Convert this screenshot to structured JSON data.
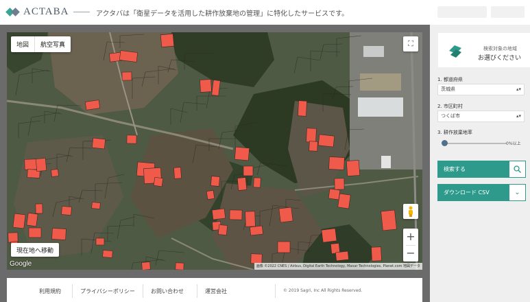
{
  "header": {
    "logo_text": "ACTABA",
    "tagline": "アクタバは「衛星データを活用した耕作放棄地の管理」に特化したサービスです。"
  },
  "map": {
    "map_type_options": [
      "地図",
      "航空写真"
    ],
    "selected_map_type": "航空写真",
    "locate_button_label": "現在地へ移動",
    "google_logo": "Google",
    "attribution": "画像 ©2022 CNES / Airbus, Digital Earth Technology, Maxar Technologies, Planet.com 地図データ",
    "zoom_in": "+",
    "zoom_out": "−",
    "parcel_color": "#f05a4b"
  },
  "footer": {
    "links": [
      "利用規約",
      "プライバシーポリシー",
      "お問い合わせ",
      "運営会社"
    ],
    "copyright": "© 2019 Sagri, Inc All Rights Reserved."
  },
  "sidebar": {
    "area_card": {
      "sub": "検索対象の地域",
      "main": "お選びください"
    },
    "prefecture": {
      "label": "1. 都道府県",
      "value": "茨城県"
    },
    "city": {
      "label": "2. 市区町村",
      "value": "つくば市"
    },
    "rate": {
      "label": "3. 耕作放棄地率",
      "value": "0%以上"
    },
    "search_button": "検索する",
    "download_button": "ダウンロード CSV",
    "accent_color": "#2d9a8b"
  }
}
